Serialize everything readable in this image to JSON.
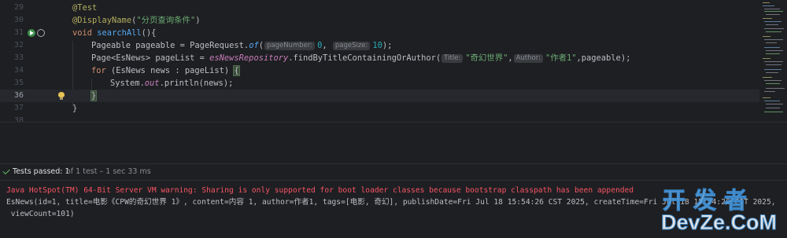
{
  "editor": {
    "lines": [
      {
        "num": "29"
      },
      {
        "num": "30"
      },
      {
        "num": "31"
      },
      {
        "num": "32"
      },
      {
        "num": "33"
      },
      {
        "num": "34"
      },
      {
        "num": "35"
      },
      {
        "num": "36"
      },
      {
        "num": "37"
      },
      {
        "num": "38"
      }
    ],
    "l29": {
      "annotation": "@Test"
    },
    "l30": {
      "annotation": "@DisplayName",
      "open": "(",
      "arg": "\"分页查询条件\"",
      "close": ")"
    },
    "l31": {
      "kw": "void",
      "name": "searchAll",
      "rest": "(){"
    },
    "l32": {
      "pre": "Pageable pageable = PageRequest.",
      "method": "of",
      "open": "(",
      "hint1": "pageNumber:",
      "v1": "0",
      "comma": ", ",
      "hint2": "pageSize:",
      "v2": "10",
      "close": ");"
    },
    "l33": {
      "pre": "Page<EsNews> pageList = ",
      "repo": "esNewsRepository",
      "dot": ".findByTitleContainingOrAuthor(",
      "hint1": "Title:",
      "s1": "\"奇幻世界\"",
      "comma": ",",
      "hint2": "Author:",
      "s2": "\"作者1\"",
      "close": ",pageable);"
    },
    "l34": {
      "kw": "for",
      "rest": " (EsNews news : pageList) ",
      "brace": "{"
    },
    "l35": {
      "pre": "System.",
      "out": "out",
      "rest": ".println(news);"
    },
    "l36": {
      "brace": "}"
    },
    "l37": {
      "text": "}"
    }
  },
  "run": {
    "status": "Tests passed: 1",
    "detail": "of 1 test – 1 sec 33 ms"
  },
  "console": {
    "warning": "Java HotSpot(TM) 64-Bit Server VM warning: Sharing is only supported for boot loader classes because bootstrap classpath has been appended",
    "output1": "EsNews(id=1, title=电影《CPW的奇幻世界 1》, content=内容 1, author=作者1, tags=[电影, 奇幻], publishDate=Fri Jul 18 15:54:26 CST 2025, createTime=Fri Jul 18 15:54:26 CST 2025,",
    "output2": " viewCount=101)"
  },
  "watermark": {
    "top": "开发者",
    "bottom": "DevZe.CoM"
  },
  "colors": {
    "background": "#1e1f22",
    "keyword": "#cf8e6d",
    "string": "#6aab73",
    "number": "#2aacb8",
    "annotation": "#b3ae60",
    "warning": "#f75464",
    "passed": "#5fb865"
  }
}
